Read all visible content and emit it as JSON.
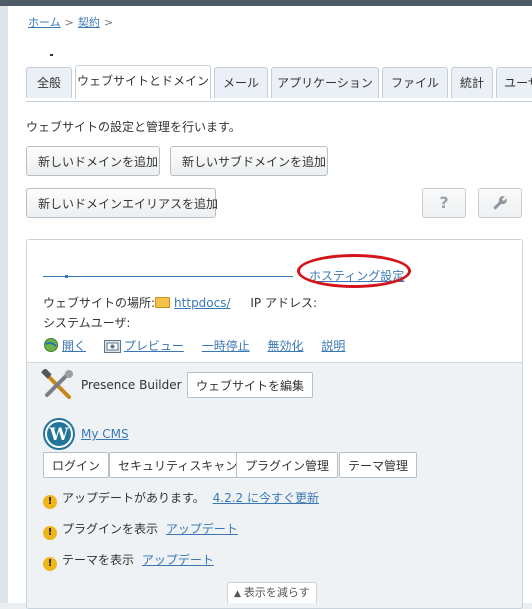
{
  "breadcrumb": {
    "home": "ホーム",
    "sep1": ">",
    "contracts": "契約",
    "sep2": ">"
  },
  "tabs": [
    "全般",
    "ウェブサイトとドメイン",
    "メール",
    "アプリケーション",
    "ファイル",
    "統計",
    "ユーザ"
  ],
  "active_tab": "ウェブサイトとドメイン",
  "description": "ウェブサイトの設定と管理を行います。",
  "buttons": {
    "add_domain": "新しいドメインを追加",
    "add_subdomain": "新しいサブドメインを追加",
    "add_alias": "新しいドメインエイリアスを追加",
    "help_icon": "?",
    "tools_icon": "wrench-icon"
  },
  "domain": {
    "hosting_settings": "ホスティング設定",
    "location_label": "ウェブサイトの場所:",
    "location_value": "httpdocs/",
    "ip_label": "IP アドレス:",
    "system_user_label": "システムユーザ:"
  },
  "actions": [
    "開く",
    "プレビュー",
    "一時停止",
    "無効化",
    "説明"
  ],
  "presence_builder": {
    "label": "Presence Builder",
    "edit_button": "ウェブサイトを編集"
  },
  "wordpress": {
    "name": "My CMS",
    "buttons": [
      "ログイン",
      "セキュリティスキャン",
      "プラグイン管理",
      "テーマ管理"
    ],
    "warnings": [
      {
        "text": "アップデートがあります。",
        "link": "4.2.2 に今すぐ更新"
      },
      {
        "text": "プラグインを表示",
        "link": "アップデート"
      },
      {
        "text": "テーマを表示",
        "link": "アップデート"
      }
    ]
  },
  "show_less": "表示を減らす",
  "colors": {
    "link": "#3a78b5",
    "highlight_ellipse": "#d4141a",
    "warning": "#f1b51c"
  }
}
